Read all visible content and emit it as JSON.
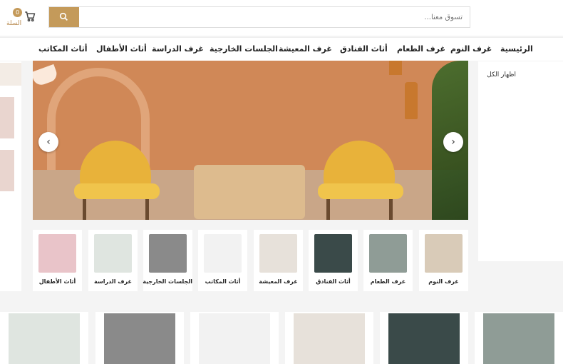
{
  "header": {
    "cart": {
      "count": "0",
      "label": "السلة",
      "icon": "cart-icon"
    },
    "search": {
      "placeholder": "تسوق معنا...",
      "button_icon": "search-icon"
    }
  },
  "nav": [
    "الرئيسية",
    "غرف النوم",
    "غرف الطعام",
    "أثاث الفنادق",
    "غرف المعيشة",
    "الجلسات الخارجية",
    "غرف الدراسة",
    "أثاث الأطفال",
    "أثاث المكاتب"
  ],
  "side_card": {
    "title": "اظهار الكل"
  },
  "categories": [
    {
      "label": "غرف النوم",
      "color": "#d9cbb8"
    },
    {
      "label": "غرف الطعام",
      "color": "#8f9c96"
    },
    {
      "label": "أثاث الفنادق",
      "color": "#3a4a49"
    },
    {
      "label": "غرف المعيشة",
      "color": "#e7e1da"
    },
    {
      "label": "أثاث المكاتب",
      "color": "#f2f2f2"
    },
    {
      "label": "الجلسات الخارجية",
      "color": "#8a8a8a"
    },
    {
      "label": "غرف الدراسة",
      "color": "#dfe5e0"
    },
    {
      "label": "أثاث الأطفال",
      "color": "#e9c4c9"
    }
  ],
  "colors": {
    "accent": "#c49a5a",
    "hero_bg": "#d08857",
    "page_bg": "#f4f4f4"
  }
}
